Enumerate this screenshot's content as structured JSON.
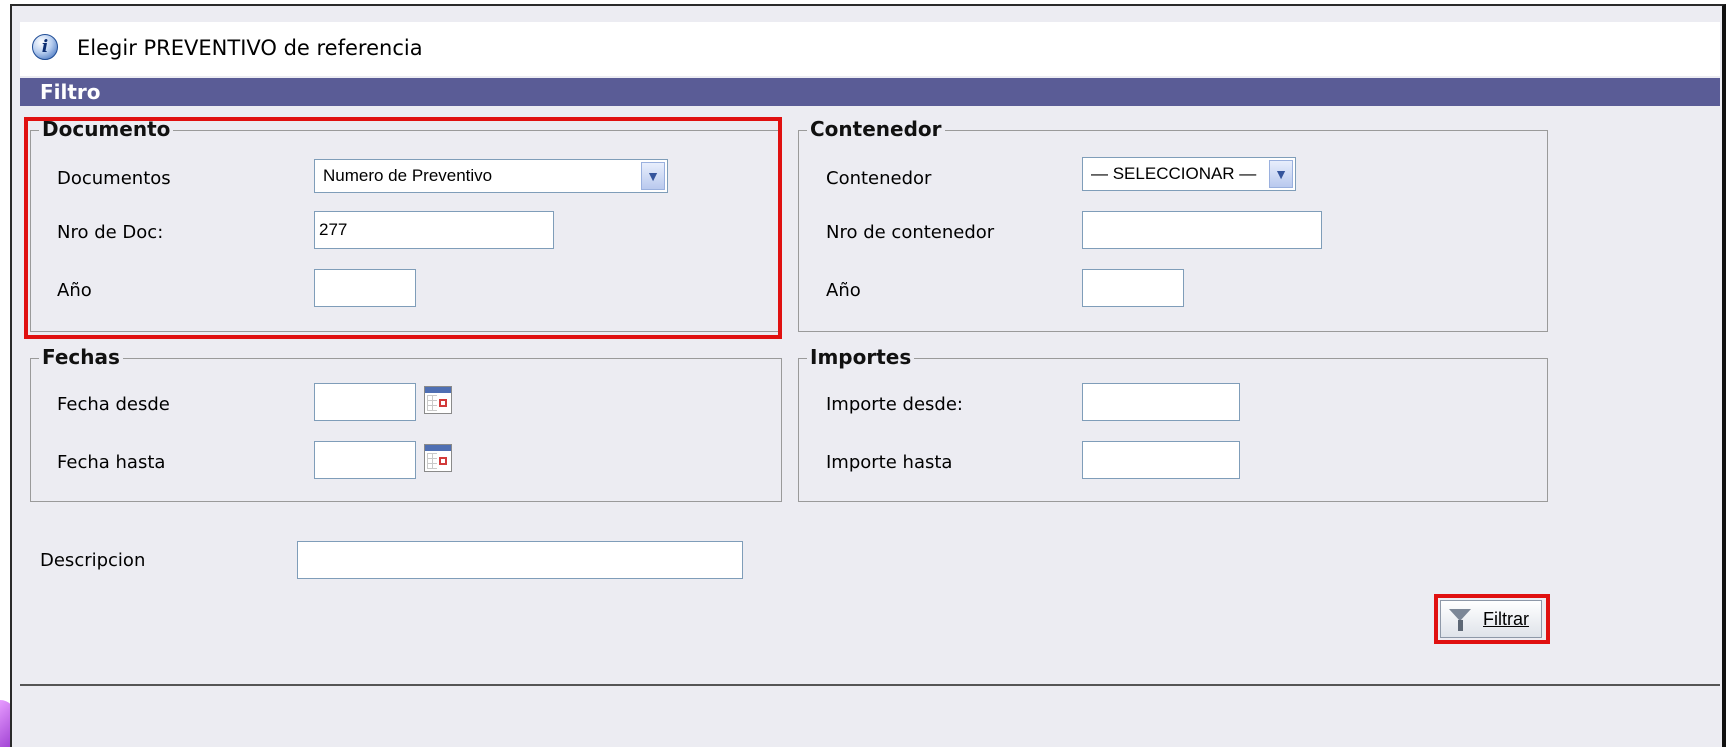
{
  "header": {
    "title": "Elegir PREVENTIVO de referencia",
    "info_icon": "info-icon"
  },
  "filter_bar": {
    "label": "Filtro"
  },
  "documento": {
    "legend": "Documento",
    "documentos_label": "Documentos",
    "documentos_value": "Numero de Preventivo",
    "nro_label": "Nro de Doc:",
    "nro_value": "277",
    "anio_label": "Año",
    "anio_value": ""
  },
  "contenedor": {
    "legend": "Contenedor",
    "contenedor_label": "Contenedor",
    "contenedor_value": "— SELECCIONAR —",
    "nro_label": "Nro de contenedor",
    "nro_value": "",
    "anio_label": "Año",
    "anio_value": ""
  },
  "fechas": {
    "legend": "Fechas",
    "desde_label": "Fecha desde",
    "desde_value": "",
    "hasta_label": "Fecha hasta",
    "hasta_value": "",
    "calendar_icon": "calendar-icon"
  },
  "importes": {
    "legend": "Importes",
    "desde_label": "Importe desde:",
    "desde_value": "",
    "hasta_label": "Importe hasta",
    "hasta_value": ""
  },
  "descripcion": {
    "label": "Descripcion",
    "value": ""
  },
  "filtrar_button": {
    "label": "Filtrar",
    "icon": "funnel-icon"
  },
  "colors": {
    "filter_bar": "#5a5c96",
    "highlight": "#e01010",
    "panel_bg": "#ececf2"
  }
}
